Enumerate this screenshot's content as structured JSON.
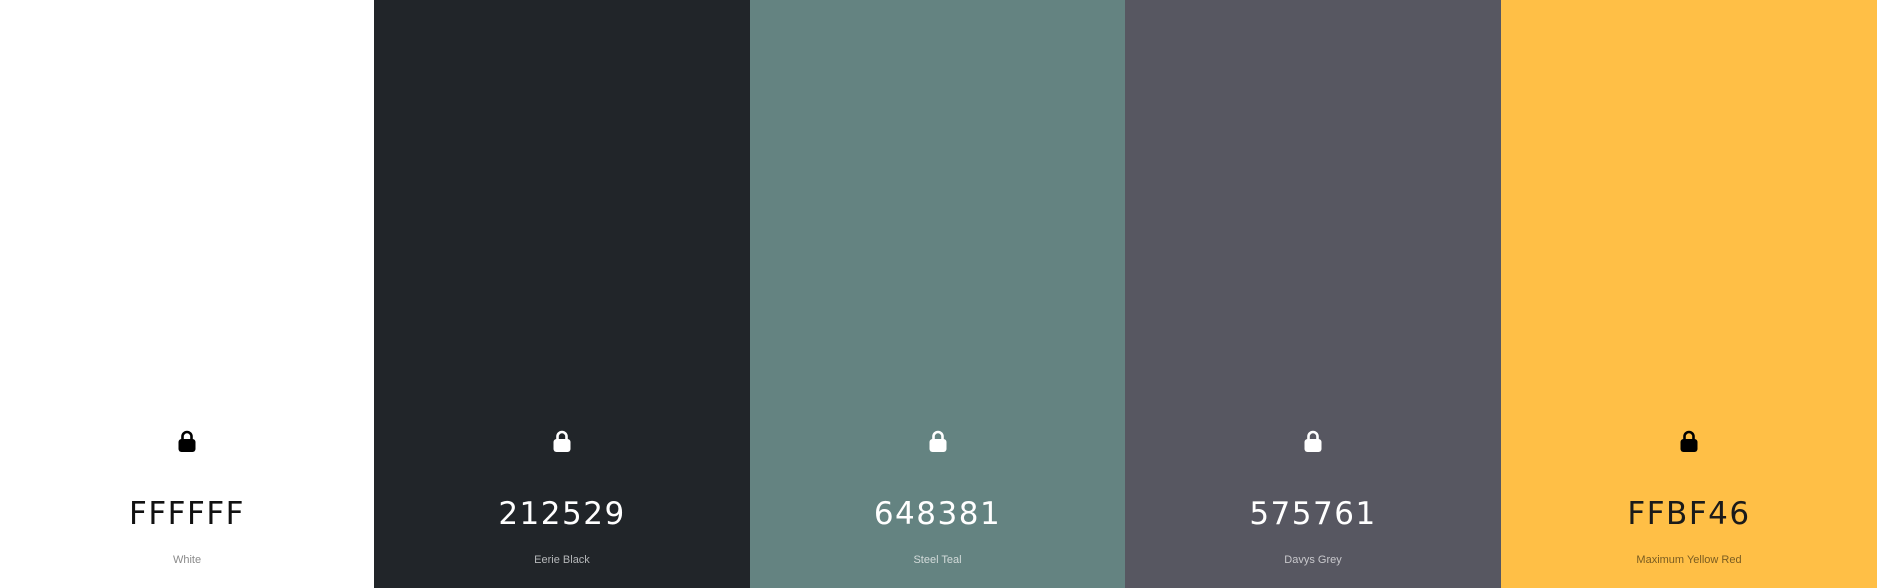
{
  "palette": {
    "colors": [
      {
        "hex": "FFFFFF",
        "name": "White",
        "background": "#FFFFFF",
        "text_color": "#111111",
        "name_color": "#8a8a8a",
        "lock_icon": "lock-icon",
        "lock_color": "#000000"
      },
      {
        "hex": "212529",
        "name": "Eerie Black",
        "background": "#212529",
        "text_color": "#FFFFFF",
        "name_color": "#b5b7b9",
        "lock_icon": "lock-icon",
        "lock_color": "#FFFFFF"
      },
      {
        "hex": "648381",
        "name": "Steel Teal",
        "background": "#648381",
        "text_color": "#FFFFFF",
        "name_color": "#d3dbda",
        "lock_icon": "lock-icon",
        "lock_color": "#FFFFFF"
      },
      {
        "hex": "575761",
        "name": "Davys Grey",
        "background": "#575761",
        "text_color": "#FFFFFF",
        "name_color": "#c8c8cc",
        "lock_icon": "lock-icon",
        "lock_color": "#FFFFFF"
      },
      {
        "hex": "FFBF46",
        "name": "Maximum Yellow Red",
        "background": "#FFBF46",
        "text_color": "#1a1a1a",
        "name_color": "#7a5c21",
        "lock_icon": "lock-icon",
        "lock_color": "#000000"
      }
    ]
  }
}
